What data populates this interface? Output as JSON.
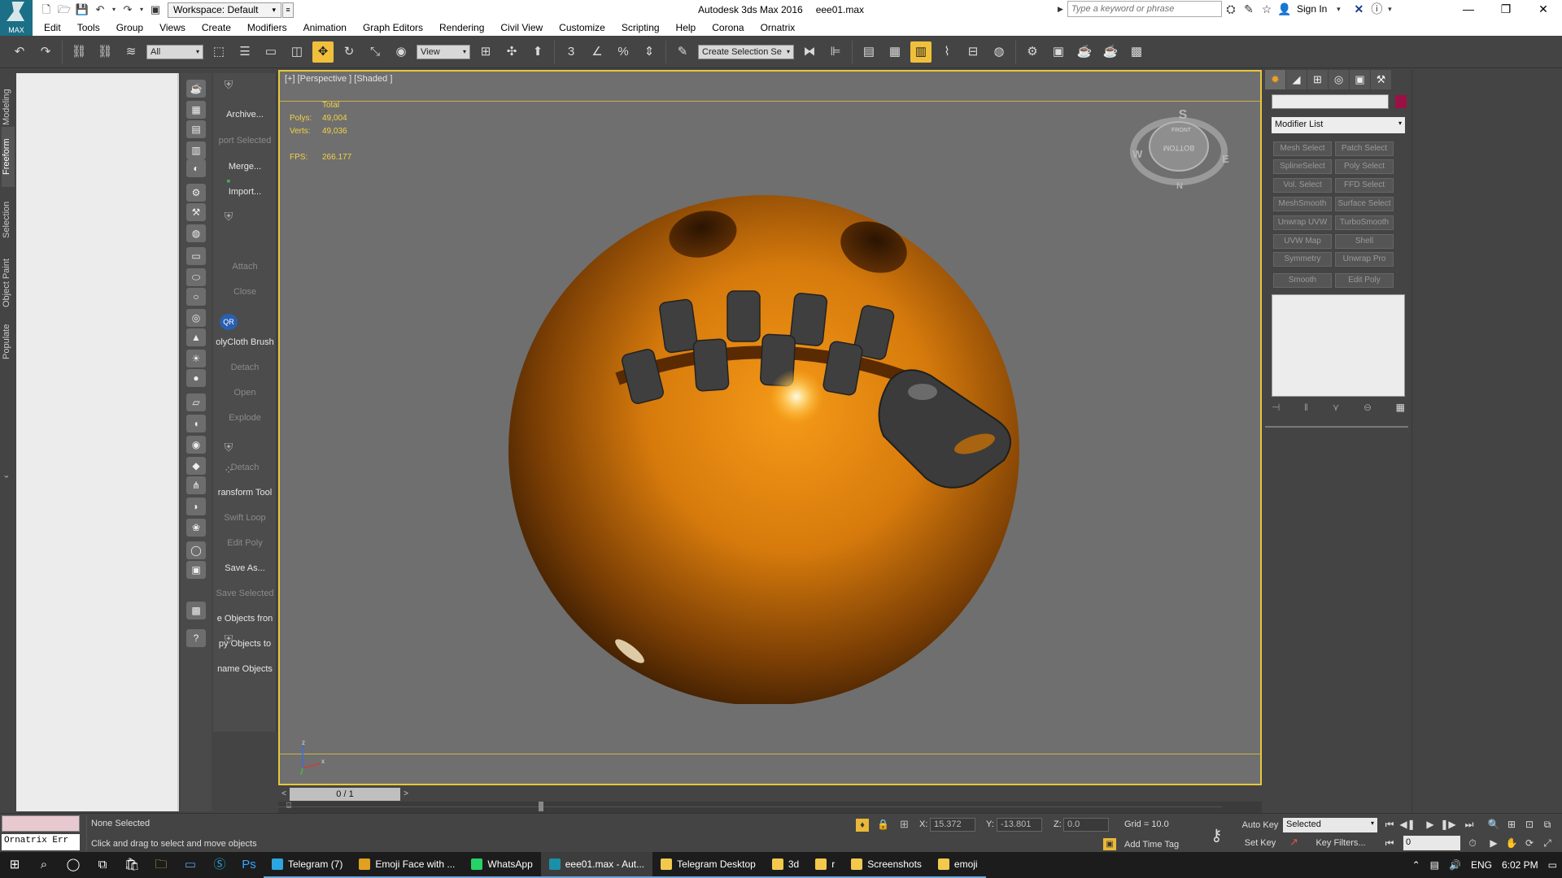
{
  "titlebar": {
    "logo_label": "MAX",
    "workspace": "Workspace: Default",
    "app_name": "Autodesk 3ds Max 2016",
    "file_name": "eee01.max",
    "search_placeholder": "Type a keyword or phrase",
    "sign_in": "Sign In"
  },
  "menu": [
    "Edit",
    "Tools",
    "Group",
    "Views",
    "Create",
    "Modifiers",
    "Animation",
    "Graph Editors",
    "Rendering",
    "Civil View",
    "Customize",
    "Scripting",
    "Help",
    "Corona",
    "Ornatrix"
  ],
  "toolbar": {
    "filter_value": "All",
    "refcoord_value": "View",
    "selection_set_placeholder": "Create Selection Se",
    "snap_label": "3"
  },
  "ribbon_tabs": [
    "Modeling",
    "Freeform",
    "Selection",
    "Object Paint",
    "Populate"
  ],
  "ribbon_active": "Freeform",
  "script_buttons": [
    {
      "label": "Archive...",
      "dim": false
    },
    {
      "label": "port Selected",
      "dim": true
    },
    {
      "label": "Merge...",
      "dim": false
    },
    {
      "label": "Import...",
      "dim": false
    },
    {
      "label": "Attach",
      "dim": true
    },
    {
      "label": "Close",
      "dim": true
    },
    {
      "label": "olyCloth Brush",
      "dim": false
    },
    {
      "label": "Detach",
      "dim": true
    },
    {
      "label": "Open",
      "dim": true
    },
    {
      "label": "Explode",
      "dim": true
    },
    {
      "label": "Detach",
      "dim": true
    },
    {
      "label": "ransform Tool",
      "dim": false
    },
    {
      "label": "Swift Loop",
      "dim": true
    },
    {
      "label": "Edit Poly",
      "dim": true
    },
    {
      "label": "Save As...",
      "dim": false
    },
    {
      "label": "Save Selected",
      "dim": true
    },
    {
      "label": "e Objects fron",
      "dim": false
    },
    {
      "label": "py Objects to",
      "dim": false
    },
    {
      "label": "name Objects",
      "dim": false
    }
  ],
  "viewport": {
    "label": "[+] [Perspective ] [Shaded ]",
    "stats_header": "Total",
    "polys_label": "Polys:",
    "polys_value": "49,004",
    "verts_label": "Verts:",
    "verts_value": "49,036",
    "fps_label": "FPS:",
    "fps_value": "266.177",
    "viewcube_front": "FRONT",
    "viewcube_bottom": "BOTTOM",
    "compass": {
      "s": "S",
      "w": "W",
      "e": "E",
      "n": "N"
    },
    "axis_z": "z",
    "axis_x": "x"
  },
  "command_panel": {
    "modifier_list": "Modifier List",
    "modifier_buttons": [
      [
        "Mesh Select",
        "Patch Select"
      ],
      [
        "SplineSelect",
        "Poly Select"
      ],
      [
        "Vol. Select",
        "FFD Select"
      ],
      [
        "MeshSmooth",
        "Surface Select"
      ],
      [
        "Unwrap UVW",
        "TurboSmooth"
      ],
      [
        "UVW Map",
        "Shell"
      ],
      [
        "Symmetry",
        "Unwrap Pro"
      ],
      [
        "Smooth",
        "Edit Poly"
      ]
    ],
    "swatch_color": "#9b1045"
  },
  "timeslider": {
    "frame": "0 / 1"
  },
  "status": {
    "script_line": "Ornatrix Err",
    "selection": "None Selected",
    "prompt": "Click and drag to select and move objects",
    "x_label": "X:",
    "x_value": "15.372",
    "y_label": "Y:",
    "y_value": "-13.801",
    "z_label": "Z:",
    "z_value": "0.0",
    "grid": "Grid = 10.0",
    "add_time_tag": "Add Time Tag",
    "auto_key": "Auto Key",
    "set_key": "Set Key",
    "selected_dropdown": "Selected",
    "key_filters": "Key Filters...",
    "frame_field": "0"
  },
  "taskbar": {
    "apps": [
      {
        "label": "Telegram (7)",
        "color": "#2ca5e0",
        "state": "open"
      },
      {
        "label": "Emoji Face with ...",
        "color": "#e0a020",
        "state": "open"
      },
      {
        "label": "WhatsApp",
        "color": "#25d366",
        "state": "open"
      },
      {
        "label": "eee01.max - Aut...",
        "color": "#1b8fa8",
        "state": "active"
      },
      {
        "label": "Telegram Desktop",
        "color": "#f2c94c",
        "state": "open"
      },
      {
        "label": "3d",
        "color": "#f2c94c",
        "state": "open"
      },
      {
        "label": "r",
        "color": "#f2c94c",
        "state": "open"
      },
      {
        "label": "Screenshots",
        "color": "#f2c94c",
        "state": "open"
      },
      {
        "label": "emoji",
        "color": "#f2c94c",
        "state": "open"
      }
    ],
    "lang": "ENG",
    "time": "6:02 PM"
  }
}
